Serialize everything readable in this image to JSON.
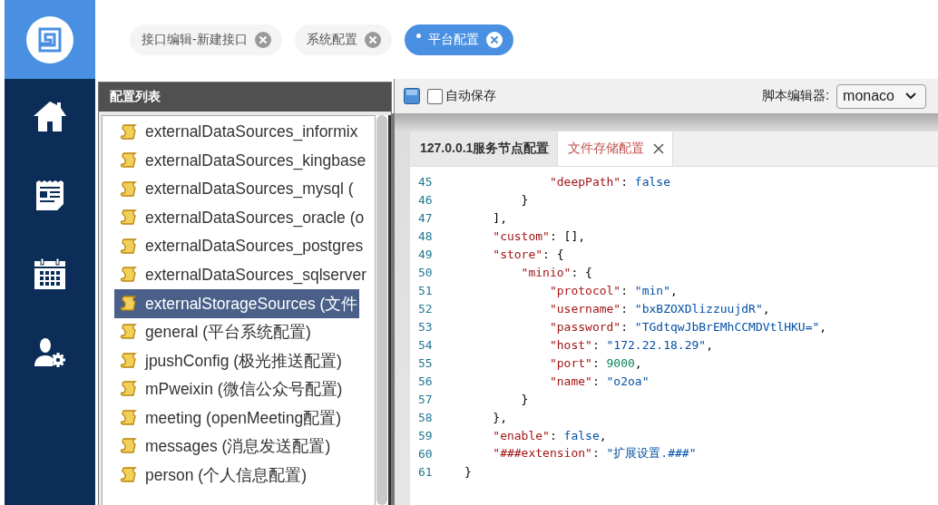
{
  "nav": {
    "items": [
      {
        "kind": "home",
        "selected": false
      },
      {
        "kind": "news",
        "selected": false
      },
      {
        "kind": "calendar",
        "selected": false
      },
      {
        "kind": "user-settings",
        "selected": false
      }
    ]
  },
  "tabs": [
    {
      "label": "接口编辑-新建接口",
      "selected": false
    },
    {
      "label": "系统配置",
      "selected": false
    },
    {
      "label": "平台配置",
      "selected": true
    }
  ],
  "config_list": {
    "title": "配置列表",
    "items": [
      {
        "label": "externalDataSources_informix",
        "selected": false
      },
      {
        "label": "externalDataSources_kingbase",
        "selected": false
      },
      {
        "label": "externalDataSources_mysql (",
        "selected": false
      },
      {
        "label": "externalDataSources_oracle (o",
        "selected": false
      },
      {
        "label": "externalDataSources_postgres",
        "selected": false
      },
      {
        "label": "externalDataSources_sqlserver",
        "selected": false
      },
      {
        "label": "externalStorageSources (文件",
        "selected": true
      },
      {
        "label": "general (平台系统配置)",
        "selected": false
      },
      {
        "label": "jpushConfig (极光推送配置)",
        "selected": false
      },
      {
        "label": "mPweixin (微信公众号配置)",
        "selected": false
      },
      {
        "label": "meeting (openMeeting配置)",
        "selected": false
      },
      {
        "label": "messages (消息发送配置)",
        "selected": false
      },
      {
        "label": "person (个人信息配置)",
        "selected": false
      }
    ]
  },
  "toolbar": {
    "auto_save": {
      "label": "自动保存",
      "checked": false
    },
    "editor_label": "脚本编辑器:",
    "editor_select": {
      "value": "monaco"
    }
  },
  "editor_tabs": [
    {
      "label": "127.0.0.1服务节点配置",
      "selected": false,
      "closable": false
    },
    {
      "label": "文件存储配置",
      "selected": true,
      "closable": true
    }
  ],
  "code_lines": [
    {
      "number": "45",
      "tokens": [
        {
          "kind": "key",
          "text": "            \"deepPath\""
        },
        {
          "kind": "punct",
          "text": ": "
        },
        {
          "kind": "bool",
          "text": "false"
        }
      ]
    },
    {
      "number": "46",
      "tokens": [
        {
          "kind": "punct",
          "text": "        }"
        }
      ]
    },
    {
      "number": "47",
      "tokens": [
        {
          "kind": "punct",
          "text": "    ],"
        }
      ]
    },
    {
      "number": "48",
      "tokens": [
        {
          "kind": "key",
          "text": "    \"custom\""
        },
        {
          "kind": "punct",
          "text": ": [],"
        }
      ]
    },
    {
      "number": "49",
      "tokens": [
        {
          "kind": "key",
          "text": "    \"store\""
        },
        {
          "kind": "punct",
          "text": ": {"
        }
      ]
    },
    {
      "number": "50",
      "tokens": [
        {
          "kind": "key",
          "text": "        \"minio\""
        },
        {
          "kind": "punct",
          "text": ": {"
        }
      ]
    },
    {
      "number": "51",
      "tokens": [
        {
          "kind": "key",
          "text": "            \"protocol\""
        },
        {
          "kind": "punct",
          "text": ": "
        },
        {
          "kind": "string",
          "text": "\"min\""
        },
        {
          "kind": "punct",
          "text": ","
        }
      ]
    },
    {
      "number": "52",
      "tokens": [
        {
          "kind": "key",
          "text": "            \"username\""
        },
        {
          "kind": "punct",
          "text": ": "
        },
        {
          "kind": "string",
          "text": "\"bxBZOXDlizzuujdR\""
        },
        {
          "kind": "punct",
          "text": ","
        }
      ]
    },
    {
      "number": "53",
      "tokens": [
        {
          "kind": "key",
          "text": "            \"password\""
        },
        {
          "kind": "punct",
          "text": ": "
        },
        {
          "kind": "string",
          "text": "\"TGdtqwJbBrEMhCCMDVtlHKU=\""
        },
        {
          "kind": "punct",
          "text": ","
        }
      ]
    },
    {
      "number": "54",
      "tokens": [
        {
          "kind": "key",
          "text": "            \"host\""
        },
        {
          "kind": "punct",
          "text": ": "
        },
        {
          "kind": "string",
          "text": "\"172.22.18.29\""
        },
        {
          "kind": "punct",
          "text": ","
        }
      ]
    },
    {
      "number": "55",
      "tokens": [
        {
          "kind": "key",
          "text": "            \"port\""
        },
        {
          "kind": "punct",
          "text": ": "
        },
        {
          "kind": "number",
          "text": "9000"
        },
        {
          "kind": "punct",
          "text": ","
        }
      ]
    },
    {
      "number": "56",
      "tokens": [
        {
          "kind": "key",
          "text": "            \"name\""
        },
        {
          "kind": "punct",
          "text": ": "
        },
        {
          "kind": "string",
          "text": "\"o2oa\""
        }
      ]
    },
    {
      "number": "57",
      "tokens": [
        {
          "kind": "punct",
          "text": "        }"
        }
      ]
    },
    {
      "number": "58",
      "tokens": [
        {
          "kind": "punct",
          "text": "    },"
        }
      ]
    },
    {
      "number": "59",
      "tokens": [
        {
          "kind": "key",
          "text": "    \"enable\""
        },
        {
          "kind": "punct",
          "text": ": "
        },
        {
          "kind": "bool",
          "text": "false"
        },
        {
          "kind": "punct",
          "text": ","
        }
      ]
    },
    {
      "number": "60",
      "tokens": [
        {
          "kind": "key",
          "text": "    \"###extension\""
        },
        {
          "kind": "punct",
          "text": ": "
        },
        {
          "kind": "string",
          "text": "\"扩展设置.###\""
        }
      ]
    },
    {
      "number": "61",
      "tokens": [
        {
          "kind": "punct",
          "text": "}"
        }
      ]
    }
  ]
}
